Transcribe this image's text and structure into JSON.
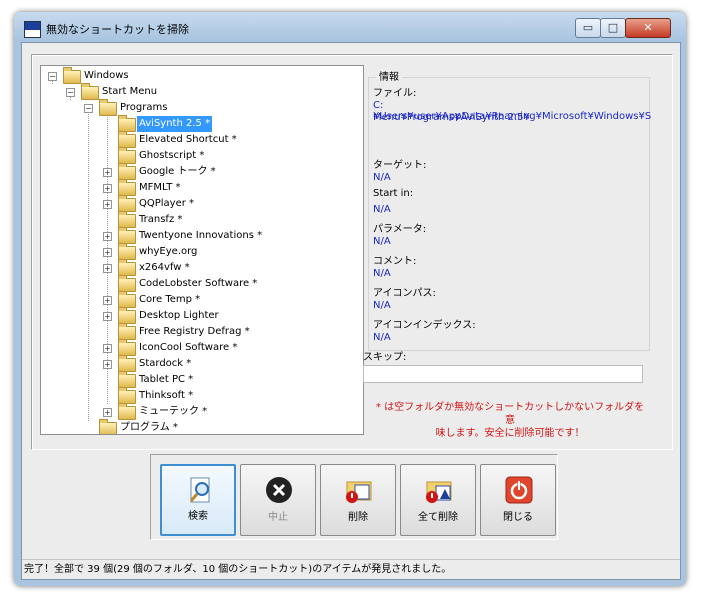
{
  "window": {
    "title": "無効なショートカットを掃除",
    "controls": {
      "minimize": "▭",
      "maximize": "□",
      "close": "✕"
    }
  },
  "tree": {
    "root": {
      "label": "Windows",
      "expander": "−"
    },
    "start_menu": {
      "label": "Start Menu",
      "expander": "−"
    },
    "programs": {
      "label": "Programs",
      "expander": "−"
    },
    "items": [
      {
        "label": "AviSynth 2.5 *",
        "expander": "",
        "selected": true
      },
      {
        "label": "Elevated Shortcut *",
        "expander": ""
      },
      {
        "label": "Ghostscript *",
        "expander": ""
      },
      {
        "label": "Google トーク *",
        "expander": "+"
      },
      {
        "label": "MFMLT *",
        "expander": "+"
      },
      {
        "label": "QQPlayer *",
        "expander": "+"
      },
      {
        "label": "Transfz *",
        "expander": ""
      },
      {
        "label": "Twentyone Innovations *",
        "expander": "+"
      },
      {
        "label": "whyEye.org",
        "expander": "+"
      },
      {
        "label": "x264vfw *",
        "expander": "+"
      },
      {
        "label": "CodeLobster Software *",
        "expander": ""
      },
      {
        "label": "Core Temp *",
        "expander": "+"
      },
      {
        "label": "Desktop Lighter",
        "expander": "+"
      },
      {
        "label": "Free Registry Defrag *",
        "expander": ""
      },
      {
        "label": "IconCool Software *",
        "expander": "+"
      },
      {
        "label": "Stardock *",
        "expander": "+"
      },
      {
        "label": "Tablet PC *",
        "expander": ""
      },
      {
        "label": "Thinksoft *",
        "expander": ""
      },
      {
        "label": "ミューテック *",
        "expander": "+"
      }
    ],
    "bottom": {
      "label": "プログラム *"
    }
  },
  "info": {
    "title": "情報",
    "file_label": "ファイル:",
    "file_value_1": "C:¥Users¥user¥AppData¥Roaming¥Microsoft¥Windows¥S",
    "file_value_2": "Menu¥Programs¥AviSynth 2.5¥",
    "target_label": "ターゲット:",
    "target_value": "N/A",
    "startin_label": "Start in:",
    "startin_value": "N/A",
    "params_label": "パラメータ:",
    "params_value": "N/A",
    "comment_label": "コメント:",
    "comment_value": "N/A",
    "iconpath_label": "アイコンパス:",
    "iconpath_value": "N/A",
    "iconindex_label": "アイコンインデックス:",
    "iconindex_value": "N/A"
  },
  "skip": {
    "label": "スキップ:",
    "value": ""
  },
  "note": {
    "line1": "* は空フォルダか無効なショートカットしかないフォルダを意",
    "line2": "味します。安全に削除可能です！"
  },
  "buttons": {
    "search": "検索",
    "stop": "中止",
    "delete": "削除",
    "delete_all": "全て削除",
    "close": "閉じる"
  },
  "status": {
    "text": "完了！全部で 39 個(29 個のフォルダ、10 個のショートカット)のアイテムが発見されました。"
  }
}
